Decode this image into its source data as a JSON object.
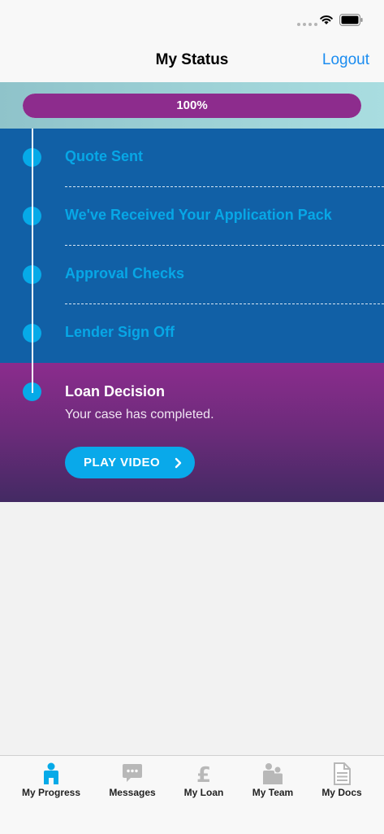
{
  "nav": {
    "title": "My Status",
    "logout_label": "Logout"
  },
  "progress": {
    "label": "100%",
    "value": 1.0
  },
  "steps": [
    {
      "label": "Quote Sent"
    },
    {
      "label": "We've Received Your Application Pack"
    },
    {
      "label": "Approval Checks"
    },
    {
      "label": "Lender Sign Off"
    }
  ],
  "current_step": {
    "title": "Loan Decision",
    "subtitle": "Your case has completed.",
    "button_label": "PLAY VIDEO"
  },
  "tabs": [
    {
      "label": "My Progress",
      "icon": "person-icon",
      "active": true
    },
    {
      "label": "Messages",
      "icon": "chat-bubble-icon",
      "active": false
    },
    {
      "label": "My Loan",
      "icon": "pound-icon",
      "active": false
    },
    {
      "label": "My Team",
      "icon": "team-icon",
      "active": false
    },
    {
      "label": "My Docs",
      "icon": "document-icon",
      "active": false
    }
  ],
  "colors": {
    "accent_blue": "#06aae8",
    "steps_background": "#1160a6",
    "progress_fill": "#8d2c8d",
    "decision_gradient_top": "#8b2c8d",
    "decision_gradient_bottom": "#432a63",
    "link_blue": "#1a8cf0",
    "tab_inactive": "#b8b8b8"
  }
}
